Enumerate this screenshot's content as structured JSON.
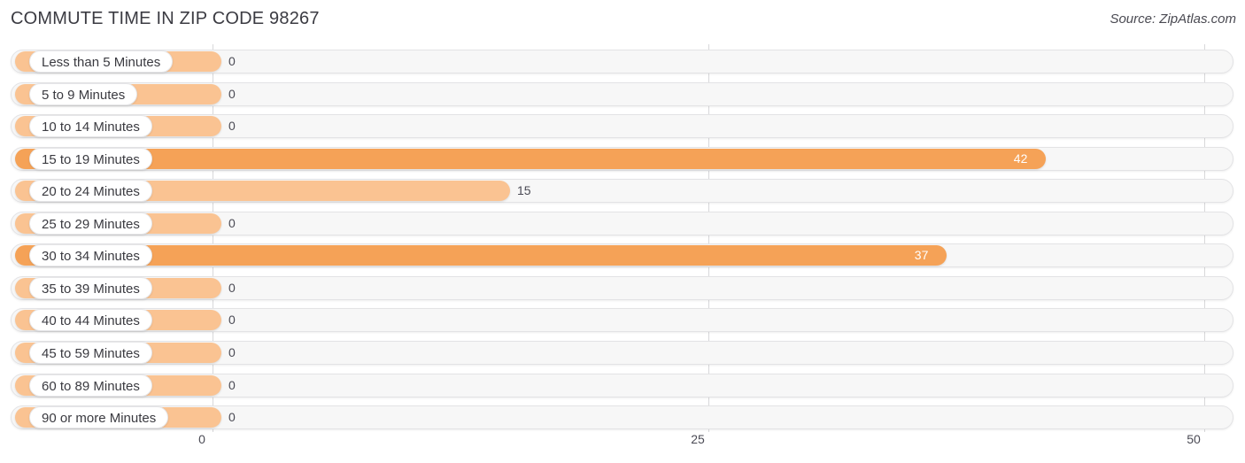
{
  "header": {
    "title": "COMMUTE TIME IN ZIP CODE 98267",
    "source": "Source: ZipAtlas.com"
  },
  "colors": {
    "bar_light": "#fac392",
    "bar_dark": "#f5a257",
    "track": "#f7f7f7",
    "gridline": "#d8d8da",
    "text": "#3a3a40"
  },
  "chart_data": {
    "type": "bar",
    "orientation": "horizontal",
    "title": "COMMUTE TIME IN ZIP CODE 98267",
    "xlabel": "",
    "ylabel": "",
    "xlim": [
      0,
      50
    ],
    "grid": true,
    "legend": "none",
    "axis_ticks": [
      {
        "label": "0",
        "value": 0
      },
      {
        "label": "25",
        "value": 25
      },
      {
        "label": "50",
        "value": 50
      }
    ],
    "categories": [
      "Less than 5 Minutes",
      "5 to 9 Minutes",
      "10 to 14 Minutes",
      "15 to 19 Minutes",
      "20 to 24 Minutes",
      "25 to 29 Minutes",
      "30 to 34 Minutes",
      "35 to 39 Minutes",
      "40 to 44 Minutes",
      "45 to 59 Minutes",
      "60 to 89 Minutes",
      "90 or more Minutes"
    ],
    "values": [
      0,
      0,
      0,
      42,
      15,
      0,
      37,
      0,
      0,
      0,
      0,
      0
    ],
    "value_labels": [
      "0",
      "0",
      "0",
      "42",
      "15",
      "0",
      "37",
      "0",
      "0",
      "0",
      "0",
      "0"
    ]
  },
  "rows": [
    {
      "label": "Less than 5 Minutes",
      "value": 0,
      "value_label": "0",
      "shade": "light",
      "label_inside": false
    },
    {
      "label": "5 to 9 Minutes",
      "value": 0,
      "value_label": "0",
      "shade": "light",
      "label_inside": false
    },
    {
      "label": "10 to 14 Minutes",
      "value": 0,
      "value_label": "0",
      "shade": "light",
      "label_inside": false
    },
    {
      "label": "15 to 19 Minutes",
      "value": 42,
      "value_label": "42",
      "shade": "dark",
      "label_inside": true
    },
    {
      "label": "20 to 24 Minutes",
      "value": 15,
      "value_label": "15",
      "shade": "light",
      "label_inside": false
    },
    {
      "label": "25 to 29 Minutes",
      "value": 0,
      "value_label": "0",
      "shade": "light",
      "label_inside": false
    },
    {
      "label": "30 to 34 Minutes",
      "value": 37,
      "value_label": "37",
      "shade": "dark",
      "label_inside": true
    },
    {
      "label": "35 to 39 Minutes",
      "value": 0,
      "value_label": "0",
      "shade": "light",
      "label_inside": false
    },
    {
      "label": "40 to 44 Minutes",
      "value": 0,
      "value_label": "0",
      "shade": "light",
      "label_inside": false
    },
    {
      "label": "45 to 59 Minutes",
      "value": 0,
      "value_label": "0",
      "shade": "light",
      "label_inside": false
    },
    {
      "label": "60 to 89 Minutes",
      "value": 0,
      "value_label": "0",
      "shade": "light",
      "label_inside": false
    },
    {
      "label": "90 or more Minutes",
      "value": 0,
      "value_label": "0",
      "shade": "light",
      "label_inside": false
    }
  ]
}
